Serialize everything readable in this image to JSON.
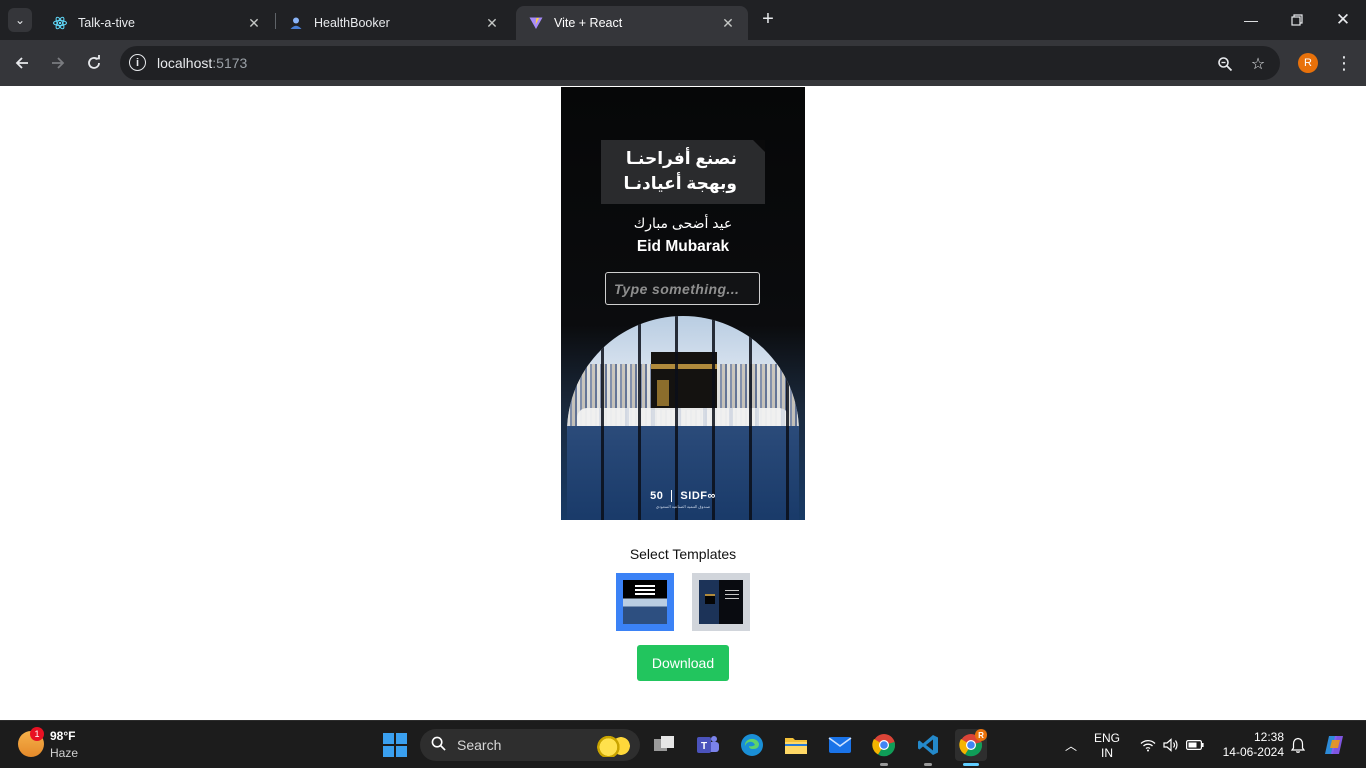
{
  "browser": {
    "tabs": [
      {
        "title": "Talk-a-tive",
        "icon": "react-icon",
        "active": false
      },
      {
        "title": "HealthBooker",
        "icon": "user-avatar-icon",
        "active": false
      },
      {
        "title": "Vite + React",
        "icon": "vite-icon",
        "active": true
      }
    ],
    "url": {
      "host": "localhost",
      "port": ":5173"
    },
    "profile_initial": "R"
  },
  "poster": {
    "banner_line1": "نصنع أفراحنـا",
    "banner_line2": "وبهجة أعيادنـا",
    "greeting_arabic": "عيد أضحى مبارك",
    "greeting_english": "Eid Mubarak",
    "input_placeholder": "Type something...",
    "logo_left": "50",
    "logo_right": "SIDF∞",
    "logo_subtitle": "صندوق التنمية الصناعية السعودي"
  },
  "templates": {
    "label": "Select Templates",
    "selected_index": 0,
    "count": 2
  },
  "download_label": "Download",
  "taskbar": {
    "weather_temp": "98°F",
    "weather_condition": "Haze",
    "weather_badge": "1",
    "search_label": "Search",
    "lang_line1": "ENG",
    "lang_line2": "IN",
    "time": "12:38",
    "date": "14-06-2024",
    "chrome_badge": "R",
    "colors": {
      "accent": "#60cdff",
      "download": "#22c55e",
      "selected_template": "#3b82f6"
    }
  }
}
